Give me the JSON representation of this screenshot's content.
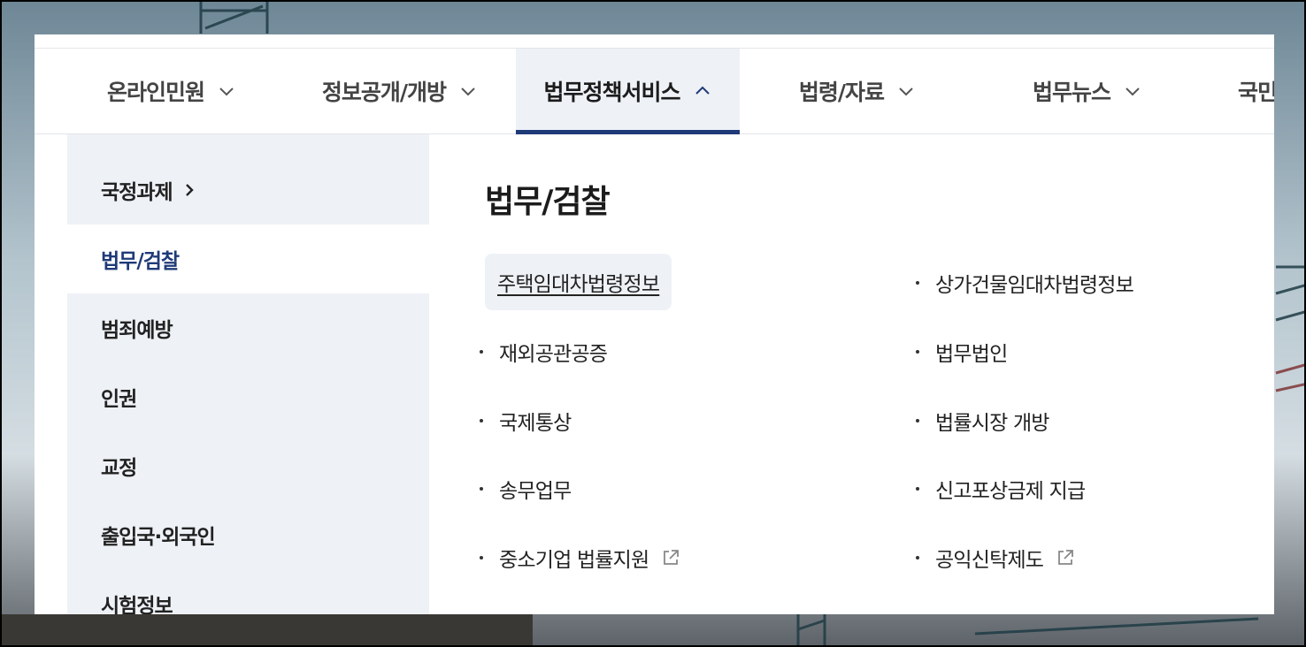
{
  "nav": {
    "items": [
      {
        "label": "온라인민원",
        "expanded": false
      },
      {
        "label": "정보공개/개방",
        "expanded": false
      },
      {
        "label": "법무정책서비스",
        "expanded": true
      },
      {
        "label": "법령/자료",
        "expanded": false
      },
      {
        "label": "법무뉴스",
        "expanded": false
      },
      {
        "label": "국민"
      }
    ]
  },
  "sidebar": {
    "items": [
      {
        "label": "국정과제"
      },
      {
        "label": "법무/검찰",
        "active": true
      },
      {
        "label": "범죄예방"
      },
      {
        "label": "인권"
      },
      {
        "label": "교정"
      },
      {
        "label": "출입국·외국인"
      },
      {
        "label": "시험정보"
      }
    ]
  },
  "content": {
    "title": "법무/검찰",
    "links": [
      {
        "label": "주택임대차법령정보",
        "highlighted": true
      },
      {
        "label": "상가건물임대차법령정보"
      },
      {
        "label": "재외공관공증"
      },
      {
        "label": "법무법인"
      },
      {
        "label": "국제통상"
      },
      {
        "label": "법률시장 개방"
      },
      {
        "label": "송무업무"
      },
      {
        "label": "신고포상금제 지급"
      },
      {
        "label": "중소기업 법률지원",
        "external": true
      },
      {
        "label": "공익신탁제도",
        "external": true
      }
    ]
  },
  "colors": {
    "accent": "#1f3a78",
    "panel_bg": "#eef1f6"
  },
  "icons": {
    "chevron": "chevron-down-icon",
    "chevron_up": "chevron-up-icon",
    "chevron_right": "chevron-right-icon",
    "external": "external-link-icon"
  }
}
